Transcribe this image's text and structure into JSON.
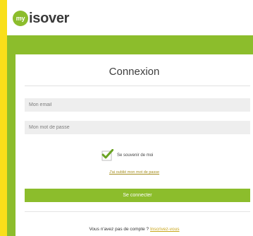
{
  "header": {
    "logo_badge": "my",
    "logo_text": "isover"
  },
  "login": {
    "title": "Connexion",
    "email_placeholder": "Mon email",
    "password_placeholder": "Mon mot de passe",
    "remember_label": "Se souvenir de moi",
    "remember_checked": true,
    "forgot_link": "J'ai oublié mon mot de passe",
    "submit_label": "Se connecter",
    "signup_prompt": "Vous n'avez pas de compte ?",
    "signup_link": "Inscrivez-vous"
  },
  "colors": {
    "background": "#f9df1a",
    "brand_green": "#8cbd2c",
    "link": "#c9a51b"
  },
  "icons": {
    "checkbox": "check-icon"
  }
}
